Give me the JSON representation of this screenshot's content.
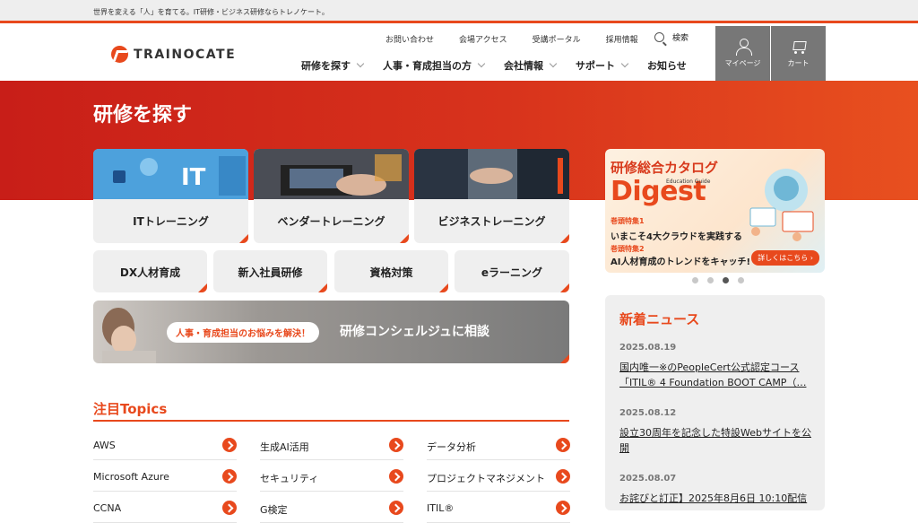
{
  "topbar": {
    "tagline": "世界を変える「人」を育てる。IT研修・ビジネス研修ならトレノケート。"
  },
  "header": {
    "logo": "TRAINOCATE",
    "util_links": [
      "お問い合わせ",
      "会場アクセス",
      "受講ポータル",
      "採用情報"
    ],
    "search_label": "検索",
    "main_nav": [
      "研修を探す",
      "人事・育成担当の方",
      "会社情報",
      "サポート",
      "お知らせ"
    ],
    "mypage_label": "マイページ",
    "cart_label": "カート"
  },
  "hero": {
    "title": "研修を探す"
  },
  "cards_large": [
    "ITトレーニング",
    "ベンダートレーニング",
    "ビジネストレーニング"
  ],
  "cards_small": [
    "DX人材育成",
    "新入社員研修",
    "資格対策",
    "eラーニング"
  ],
  "consult": {
    "badge": "人事・育成担当のお悩みを解決！",
    "text": "研修コンシェルジュに相談"
  },
  "topics": {
    "title": "注目Topics",
    "items": [
      "AWS",
      "生成AI活用",
      "データ分析",
      "Microsoft Azure",
      "セキュリティ",
      "プロジェクトマネジメント",
      "CCNA",
      "G検定",
      "ITIL®"
    ]
  },
  "banner": {
    "headline": "研修総合カタログ",
    "title": "Digest",
    "subtitle": "Education Guide",
    "feature1_label": "巻頭特集1",
    "feature1_text": "いまこそ4大クラウドを実践する",
    "feature2_label": "巻頭特集2",
    "feature2_text": "AI人材育成のトレンドをキャッチ!",
    "cta": "詳しくはこちら ›"
  },
  "news": {
    "title": "新着ニュース",
    "items": [
      {
        "date": "2025.08.19",
        "text": "国内唯一※のPeopleCert公式認定コース「ITIL® 4 Foundation BOOT CAMP（…"
      },
      {
        "date": "2025.08.12",
        "text": "設立30周年を記念した特設Webサイトを公開"
      },
      {
        "date": "2025.08.07",
        "text": "お詫びと訂正】2025年8月6日 10:10配信"
      }
    ]
  },
  "colors": {
    "accent": "#e8491d",
    "hero": "#d8331c",
    "header_button": "#777777"
  }
}
